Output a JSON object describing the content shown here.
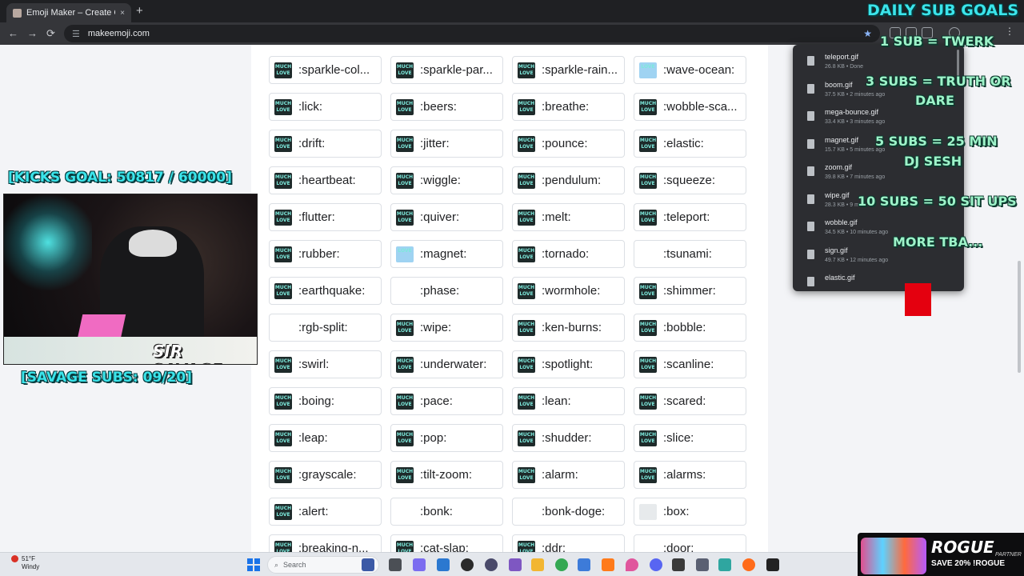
{
  "browser": {
    "tab_title": "Emoji Maker – Create Custom",
    "tab_close": "×",
    "new_tab": "+",
    "url": "makeemoji.com",
    "back": "←",
    "forward": "→",
    "reload": "⟳",
    "bookmark_star": "★"
  },
  "emoji_cards": [
    {
      "code": ":sparkle-col...",
      "icon": "MUCH LOVE"
    },
    {
      "code": ":sparkle-par...",
      "icon": "MUCH LOVE"
    },
    {
      "code": ":sparkle-rain...",
      "icon": "MUCH LOVE"
    },
    {
      "code": ":wave-ocean:",
      "icon": "LOVE"
    },
    {
      "code": ":lick:",
      "icon": "MUCH LOVE"
    },
    {
      "code": ":beers:",
      "icon": "MUCH LOVE"
    },
    {
      "code": ":breathe:",
      "icon": "MUCH LOVE"
    },
    {
      "code": ":wobble-sca...",
      "icon": "MUCH LOVE"
    },
    {
      "code": ":drift:",
      "icon": "MUCH LOVE"
    },
    {
      "code": ":jitter:",
      "icon": "MUCH LOVE"
    },
    {
      "code": ":pounce:",
      "icon": "MUCH LOVE"
    },
    {
      "code": ":elastic:",
      "icon": "MUCH LOVE"
    },
    {
      "code": ":heartbeat:",
      "icon": "MUCH LOVE"
    },
    {
      "code": ":wiggle:",
      "icon": "MUCH LOVE"
    },
    {
      "code": ":pendulum:",
      "icon": "MUCH LOVE"
    },
    {
      "code": ":squeeze:",
      "icon": "MUCH LOVE"
    },
    {
      "code": ":flutter:",
      "icon": "MUCH LOVE"
    },
    {
      "code": ":quiver:",
      "icon": "MUCH LOVE"
    },
    {
      "code": ":melt:",
      "icon": "MUCH LOVE"
    },
    {
      "code": ":teleport:",
      "icon": "MUCH LOVE"
    },
    {
      "code": ":rubber:",
      "icon": "MUCH LOVE"
    },
    {
      "code": ":magnet:",
      "icon": "LOVE"
    },
    {
      "code": ":tornado:",
      "icon": "MUCH LOVE"
    },
    {
      "code": ":tsunami:",
      "icon": ""
    },
    {
      "code": ":earthquake:",
      "icon": "MUCH LOVE"
    },
    {
      "code": ":phase:",
      "icon": ""
    },
    {
      "code": ":wormhole:",
      "icon": "MUCH LOVE"
    },
    {
      "code": ":shimmer:",
      "icon": "MUCH LOVE"
    },
    {
      "code": ":rgb-split:",
      "icon": ""
    },
    {
      "code": ":wipe:",
      "icon": "MUCH LOVE"
    },
    {
      "code": ":ken-burns:",
      "icon": "MUCH LOVE"
    },
    {
      "code": ":bobble:",
      "icon": "MUCH LOVE"
    },
    {
      "code": ":swirl:",
      "icon": "MUCH LOVE"
    },
    {
      "code": ":underwater:",
      "icon": "MUCH LOVE"
    },
    {
      "code": ":spotlight:",
      "icon": "MUCH LOVE"
    },
    {
      "code": ":scanline:",
      "icon": "MUCH LOVE"
    },
    {
      "code": ":boing:",
      "icon": "MUCH LOVE"
    },
    {
      "code": ":pace:",
      "icon": "MUCH LOVE"
    },
    {
      "code": ":lean:",
      "icon": "MUCH LOVE"
    },
    {
      "code": ":scared:",
      "icon": "MUCH LOVE"
    },
    {
      "code": ":leap:",
      "icon": "MUCH LOVE"
    },
    {
      "code": ":pop:",
      "icon": "MUCH LOVE"
    },
    {
      "code": ":shudder:",
      "icon": "MUCH LOVE"
    },
    {
      "code": ":slice:",
      "icon": "MUCH LOVE"
    },
    {
      "code": ":grayscale:",
      "icon": "MUCH LOVE"
    },
    {
      "code": ":tilt-zoom:",
      "icon": "MUCH LOVE"
    },
    {
      "code": ":alarm:",
      "icon": "MUCH LOVE"
    },
    {
      "code": ":alarms:",
      "icon": "MUCH LOVE"
    },
    {
      "code": ":alert:",
      "icon": "MUCH LOVE"
    },
    {
      "code": ":bonk:",
      "icon": ""
    },
    {
      "code": ":bonk-doge:",
      "icon": ""
    },
    {
      "code": ":box:",
      "icon": ""
    },
    {
      "code": ":breaking-n...",
      "icon": "MUCH LOVE"
    },
    {
      "code": ":cat-slap:",
      "icon": "MUCH LOVE"
    },
    {
      "code": ":ddr:",
      "icon": "MUCH LOVE"
    },
    {
      "code": ":door:",
      "icon": ""
    }
  ],
  "downloads": [
    {
      "name": "teleport.gif",
      "meta": "26.8 KB • Done"
    },
    {
      "name": "boom.gif",
      "meta": "37.5 KB • 2 minutes ago"
    },
    {
      "name": "mega-bounce.gif",
      "meta": "33.4 KB • 3 minutes ago"
    },
    {
      "name": "magnet.gif",
      "meta": "15.7 KB • 5 minutes ago"
    },
    {
      "name": "zoom.gif",
      "meta": "39.8 KB • 7 minutes ago"
    },
    {
      "name": "wipe.gif",
      "meta": "28.3 KB • 9 m"
    },
    {
      "name": "wobble.gif",
      "meta": "34.5 KB • 10 minutes ago"
    },
    {
      "name": "sign.gif",
      "meta": "49.7 KB • 12 minutes ago"
    },
    {
      "name": "elastic.gif",
      "meta": ""
    }
  ],
  "overlay": {
    "kicks_goal": "[KICKS GOAL: 50817 / 60000]",
    "savage_subs": "[SAVAGE SUBS: 09/20]",
    "daily_title": "DAILY SUB GOALS",
    "goal1": "1 SUB = TWERK",
    "goal2a": "3 SUBS = TRUTH OR",
    "goal2b": "DARE",
    "goal3a": "5 SUBS = 25 MIN",
    "goal3b": "DJ SESH",
    "goal4": "10 SUBS = 50 SIT UPS",
    "goal5": "MORE TBA...",
    "nameplate": "SIR SAVAGE"
  },
  "taskbar": {
    "temp": "51°F",
    "condition": "Windy",
    "search_placeholder": "Search"
  },
  "promo": {
    "brand": "ROGUE",
    "partner": "PARTNER",
    "offer": "SAVE 20% !ROGUE"
  },
  "colors": {
    "overlay_cyan": "#3be4ea",
    "overlay_mint": "#9ef3c9",
    "downloads_bg": "#2c2d31"
  }
}
